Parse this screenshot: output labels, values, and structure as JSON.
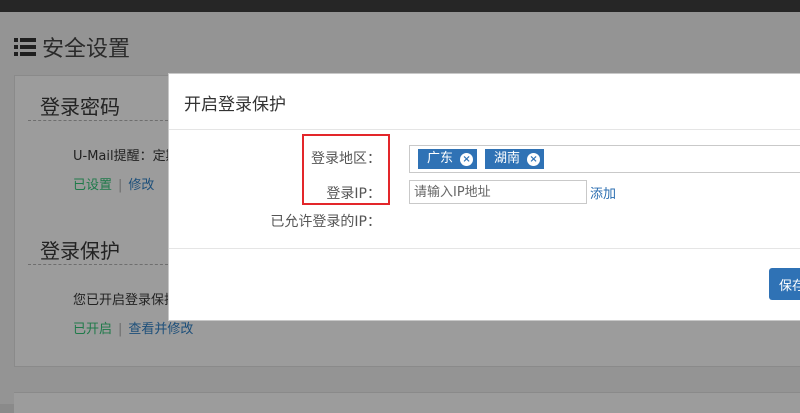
{
  "page": {
    "title": "安全设置"
  },
  "sections": {
    "password": {
      "title": "登录密码",
      "text": "U-Mail提醒：定期",
      "status": "已设置",
      "sep": "|",
      "action": "修改"
    },
    "protect": {
      "title": "登录保护",
      "text": "您已开启登录保护",
      "status": "已开启",
      "sep": "|",
      "action": "查看并修改"
    }
  },
  "modal": {
    "title": "开启登录保护",
    "fields": {
      "region_label": "登录地区：",
      "ip_label": "登录IP：",
      "allowed_label": "已允许登录的IP："
    },
    "tags": [
      {
        "label": "广东",
        "close": "×"
      },
      {
        "label": "湖南",
        "close": "×"
      }
    ],
    "ip_input": {
      "value": "",
      "placeholder": "请输入IP地址"
    },
    "add_label": "添加",
    "save_label": "保存"
  },
  "colors": {
    "accent": "#2f72b5",
    "highlight": "#e3262a",
    "status_green": "#1f7a4a"
  }
}
